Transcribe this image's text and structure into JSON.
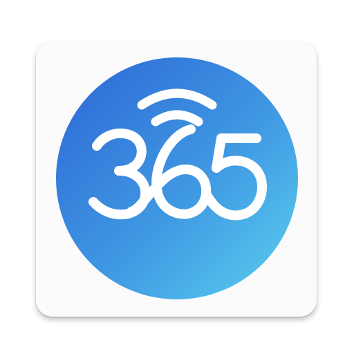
{
  "app_icon": {
    "logo_text": "365",
    "colors": {
      "tile": "#fbfbfb",
      "gradient_start": "#2f6fd8",
      "gradient_end": "#56c9ee",
      "glyph": "#ffffff"
    },
    "icons": [
      "wifi-signal-icon"
    ]
  }
}
